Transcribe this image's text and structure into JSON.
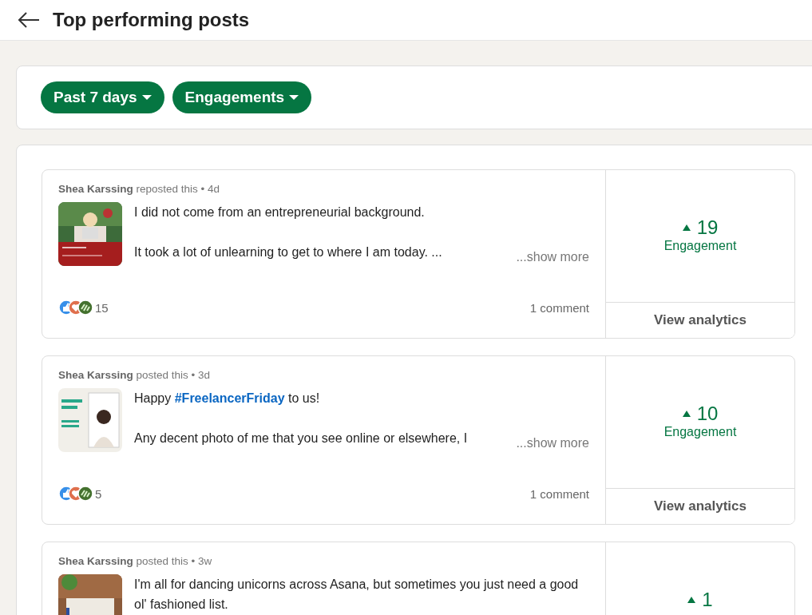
{
  "header": {
    "title": "Top performing posts"
  },
  "filters": [
    {
      "label": "Past 7 days"
    },
    {
      "label": "Engagements"
    }
  ],
  "posts": [
    {
      "author": "Shea Karssing",
      "action": "reposted this • 4d",
      "thumbnail": {
        "kind": "picture"
      },
      "lines": [
        [
          {
            "kind": "plain",
            "text": "I did not come from an entrepreneurial background."
          }
        ],
        [
          {
            "kind": "plain",
            "text": "It took a lot of unlearning to get to where I am today. ..."
          }
        ]
      ],
      "show_more": "...show more",
      "reactions": "15",
      "comments": "1 comment",
      "metric": "19",
      "metric_label": "Engagement",
      "analytics": "View analytics"
    },
    {
      "author": "Shea Karssing",
      "action": "posted this • 3d",
      "thumbnail": {
        "kind": "picture"
      },
      "lines": [
        [
          {
            "kind": "plain",
            "text": "Happy "
          },
          {
            "kind": "hashtag",
            "text": "#FreelancerFriday"
          },
          {
            "kind": "plain",
            "text": " to us!"
          }
        ],
        [
          {
            "kind": "plain",
            "text": "Any decent photo of me that you see online or elsewhere, I"
          }
        ]
      ],
      "show_more": "...show more",
      "reactions": "5",
      "comments": "1 comment",
      "metric": "10",
      "metric_label": "Engagement",
      "analytics": "View analytics"
    },
    {
      "author": "Shea Karssing",
      "action": "posted this • 3w",
      "thumbnail": {
        "kind": "picture"
      },
      "lines": [
        [
          {
            "kind": "plain",
            "text": "I'm all for dancing unicorns across Asana, but sometimes you just need a good ol' fashioned list."
          }
        ]
      ],
      "metric": "1"
    }
  ]
}
